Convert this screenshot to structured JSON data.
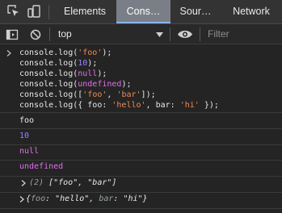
{
  "tabs": [
    {
      "label": "Elements",
      "active": false
    },
    {
      "label": "Cons…",
      "active": true
    },
    {
      "label": "Sour…",
      "active": false
    },
    {
      "label": "Network",
      "active": false
    }
  ],
  "toolbar": {
    "context": "top",
    "filter_placeholder": "Filter"
  },
  "code": {
    "lines": [
      [
        "console.log(",
        "'foo'",
        ");"
      ],
      [
        "console.log(",
        "10",
        ");"
      ],
      [
        "console.log(",
        "null",
        ");"
      ],
      [
        "console.log(",
        "undefined",
        ");"
      ],
      [
        "console.log([",
        "'foo'",
        ", ",
        "'bar'",
        "]);"
      ],
      [
        "console.log({ foo: ",
        "'hello'",
        ", bar: ",
        "'hi'",
        " });"
      ]
    ]
  },
  "output": {
    "foo": "foo",
    "ten": "10",
    "null": "null",
    "undefined": "undefined",
    "array": {
      "count": "(2)",
      "open": "[",
      "item1": "\"foo\"",
      "comma": ", ",
      "item2": "\"bar\"",
      "close": "]"
    },
    "object": {
      "open": "{",
      "key1": "foo",
      "colon1": ": ",
      "val1": "\"hello\"",
      "comma": ", ",
      "key2": "bar",
      "colon2": ": ",
      "val2": "\"hi\"",
      "close": "}"
    }
  },
  "colors": {
    "active_tab": "#7a7f87",
    "string": "#f28b54",
    "number": "#9980ff",
    "keyword": "#e36eec"
  }
}
